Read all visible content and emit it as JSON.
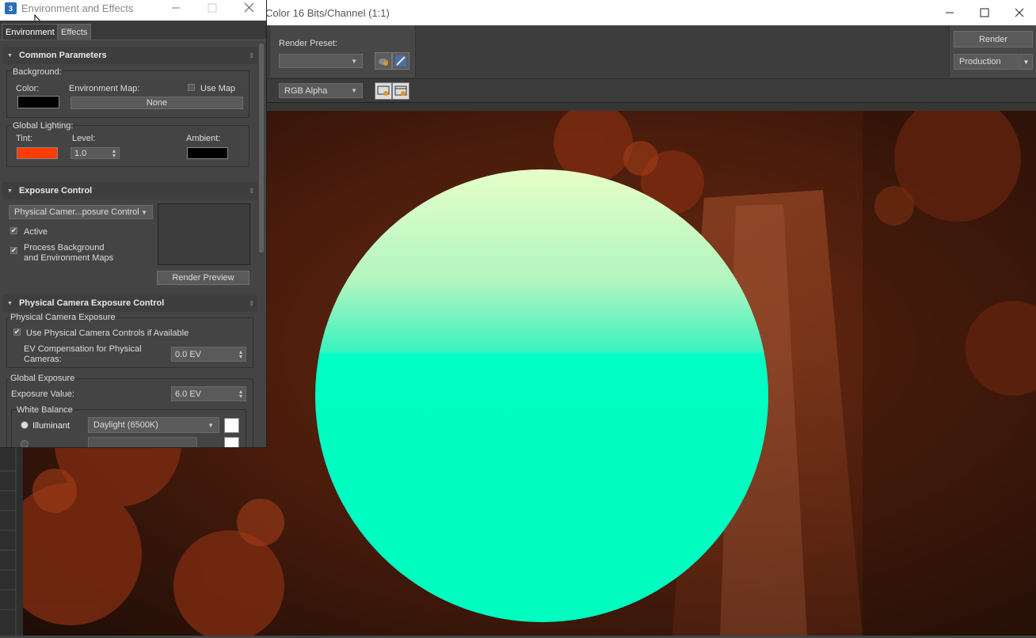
{
  "render_frame": {
    "title": "Color 16 Bits/Channel (1:1)",
    "render_preset_label": "Render Preset:",
    "render_preset_value": "",
    "channel_value": "RGB Alpha",
    "render_button": "Render",
    "production_value": "Production"
  },
  "env_dialog": {
    "title": "Environment and Effects",
    "tabs": [
      "Environment",
      "Effects"
    ],
    "common": {
      "header": "Common Parameters",
      "background_label": "Background:",
      "color_label": "Color:",
      "env_map_label": "Environment Map:",
      "use_map_label": "Use Map",
      "env_map_button": "None",
      "global_lighting_label": "Global Lighting:",
      "tint_label": "Tint:",
      "level_label": "Level:",
      "level_value": "1.0",
      "ambient_label": "Ambient:",
      "background_color": "#000000",
      "tint_color": "#ff3c00",
      "ambient_color": "#000000"
    },
    "exposure": {
      "header": "Exposure Control",
      "type_value": "Physical Camer...posure Control",
      "active_label": "Active",
      "process_bg_line1": "Process Background",
      "process_bg_line2": "and Environment Maps",
      "render_preview_button": "Render Preview"
    },
    "physical": {
      "header": "Physical Camera Exposure Control",
      "group_label": "Physical Camera Exposure",
      "use_controls_label": "Use Physical Camera Controls if Available",
      "ev_comp_line1": "EV Compensation for Physical",
      "ev_comp_line2": "Cameras:",
      "ev_comp_value": "0.0 EV",
      "global_exposure_label": "Global Exposure",
      "exposure_value_label": "Exposure Value:",
      "exposure_value": "6.0 EV",
      "white_balance_label": "White Balance",
      "illuminant_label": "Illuminant",
      "illuminant_value": "Daylight (6500K)"
    }
  },
  "colors": {
    "sphere_top": "#e6ffc8",
    "sphere_bottom": "#00ffc4",
    "background_warm": "#7a2a10"
  }
}
